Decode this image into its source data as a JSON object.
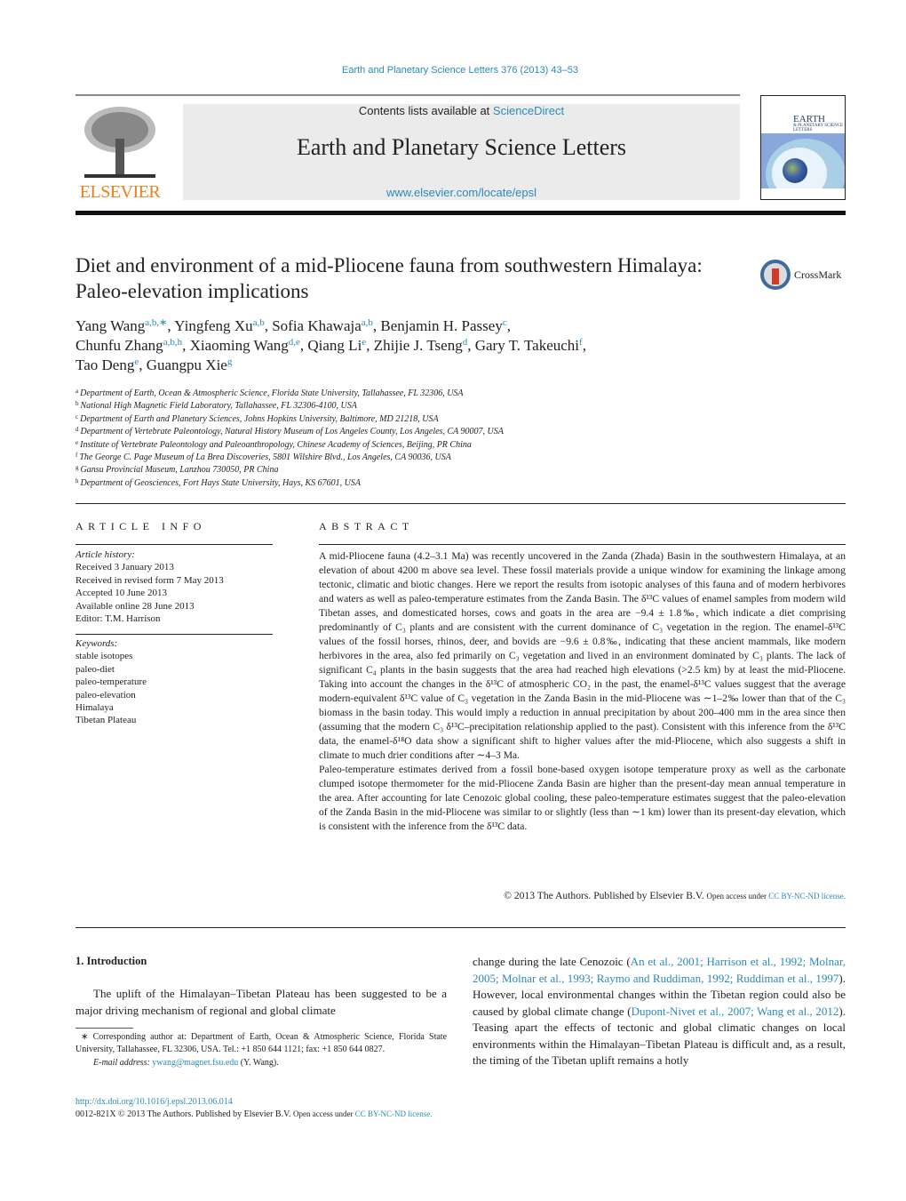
{
  "header": {
    "journal_ref": "Earth and Planetary Science Letters 376 (2013) 43–53",
    "contents_prefix": "Contents lists available at ",
    "contents_link": "ScienceDirect",
    "journal_title": "Earth and Planetary Science Letters",
    "journal_url": "www.elsevier.com/locate/epsl",
    "publisher_logo": "ELSEVIER",
    "cover_title": "EARTH",
    "cover_subtitle": "& PLANETARY SCIENCE LETTERS"
  },
  "crossmark": {
    "label": "CrossMark"
  },
  "article": {
    "title": "Diet and environment of a mid-Pliocene fauna from southwestern Himalaya: Paleo-elevation implications",
    "authors": [
      {
        "name": "Yang Wang",
        "sup": "a,b,∗",
        "sep": ", "
      },
      {
        "name": "Yingfeng Xu",
        "sup": "a,b",
        "sep": ", "
      },
      {
        "name": "Sofia Khawaja",
        "sup": "a,b",
        "sep": ", "
      },
      {
        "name": "Benjamin H. Passey",
        "sup": "c",
        "sep": ","
      },
      {
        "name": "Chunfu Zhang",
        "sup": "a,b,h",
        "sep": ", "
      },
      {
        "name": "Xiaoming Wang",
        "sup": "d,e",
        "sep": ", "
      },
      {
        "name": "Qiang Li",
        "sup": "e",
        "sep": ", "
      },
      {
        "name": "Zhijie J. Tseng",
        "sup": "d",
        "sep": ", "
      },
      {
        "name": "Gary T. Takeuchi",
        "sup": "f",
        "sep": ","
      },
      {
        "name": "Tao Deng",
        "sup": "e",
        "sep": ", "
      },
      {
        "name": "Guangpu Xie",
        "sup": "g",
        "sep": ""
      }
    ],
    "affiliations": [
      {
        "key": "a",
        "text": "Department of Earth, Ocean & Atmospheric Science, Florida State University, Tallahassee, FL 32306, USA"
      },
      {
        "key": "b",
        "text": "National High Magnetic Field Laboratory, Tallahassee, FL 32306-4100, USA"
      },
      {
        "key": "c",
        "text": "Department of Earth and Planetary Sciences, Johns Hopkins University, Baltimore, MD 21218, USA"
      },
      {
        "key": "d",
        "text": "Department of Vertebrate Paleontology, Natural History Museum of Los Angeles County, Los Angeles, CA 90007, USA"
      },
      {
        "key": "e",
        "text": "Institute of Vertebrate Paleontology and Paleoanthropology, Chinese Academy of Sciences, Beijing, PR China"
      },
      {
        "key": "f",
        "text": "The George C. Page Museum of La Brea Discoveries, 5801 Wilshire Blvd., Los Angeles, CA 90036, USA"
      },
      {
        "key": "g",
        "text": "Gansu Provincial Museum, Lanzhou 730050, PR China"
      },
      {
        "key": "h",
        "text": "Department of Geosciences, Fort Hays State University, Hays, KS 67601, USA"
      }
    ]
  },
  "article_info": {
    "heading": "ARTICLE INFO",
    "history_label": "Article history:",
    "history": [
      "Received 3 January 2013",
      "Received in revised form 7 May 2013",
      "Accepted 10 June 2013",
      "Available online 28 June 2013",
      "Editor: T.M. Harrison"
    ],
    "keywords_label": "Keywords:",
    "keywords": [
      "stable isotopes",
      "paleo-diet",
      "paleo-temperature",
      "paleo-elevation",
      "Himalaya",
      "Tibetan Plateau"
    ]
  },
  "abstract": {
    "heading": "ABSTRACT",
    "paragraphs": [
      "A mid-Pliocene fauna (4.2–3.1 Ma) was recently uncovered in the Zanda (Zhada) Basin in the southwestern Himalaya, at an elevation of about 4200 m above sea level. These fossil materials provide a unique window for examining the linkage among tectonic, climatic and biotic changes. Here we report the results from isotopic analyses of this fauna and of modern herbivores and waters as well as paleo-temperature estimates from the Zanda Basin. The δ¹³C values of enamel samples from modern wild Tibetan asses, and domesticated horses, cows and goats in the area are −9.4 ± 1.8‰, which indicate a diet comprising predominantly of C₃ plants and are consistent with the current dominance of C₃ vegetation in the region. The enamel-δ¹³C values of the fossil horses, rhinos, deer, and bovids are −9.6 ± 0.8‰, indicating that these ancient mammals, like modern herbivores in the area, also fed primarily on C₃ vegetation and lived in an environment dominated by C₃ plants. The lack of significant C₄ plants in the basin suggests that the area had reached high elevations (>2.5 km) by at least the mid-Pliocene. Taking into account the changes in the δ¹³C of atmospheric CO₂ in the past, the enamel-δ¹³C values suggest that the average modern-equivalent δ¹³C value of C₃ vegetation in the Zanda Basin in the mid-Pliocene was ∼1–2‰ lower than that of the C₃ biomass in the basin today. This would imply a reduction in annual precipitation by about 200–400 mm in the area since then (assuming that the modern C₃ δ¹³C–precipitation relationship applied to the past). Consistent with this inference from the δ¹³C data, the enamel-δ¹⁸O data show a significant shift to higher values after the mid-Pliocene, which also suggests a shift in climate to much drier conditions after ∼4–3 Ma.",
      "Paleo-temperature estimates derived from a fossil bone-based oxygen isotope temperature proxy as well as the carbonate clumped isotope thermometer for the mid-Pliocene Zanda Basin are higher than the present-day mean annual temperature in the area. After accounting for late Cenozoic global cooling, these paleo-temperature estimates suggest that the paleo-elevation of the Zanda Basin in the mid-Pliocene was similar to or slightly (less than ∼1 km) lower than its present-day elevation, which is consistent with the inference from the δ¹³C data."
    ],
    "copyright": "© 2013 The Authors. Published by Elsevier B.V.",
    "open_access": "Open access under ",
    "license_link": "CC BY-NC-ND license."
  },
  "introduction": {
    "heading": "1. Introduction",
    "left_text": "The uplift of the Himalayan–Tibetan Plateau has been suggested to be a major driving mechanism of regional and global climate",
    "right_parts": [
      {
        "text": "change during the late Cenozoic (",
        "link": false
      },
      {
        "text": "An et al., 2001; Harrison et al., 1992; Molnar, 2005; Molnar et al., 1993; Raymo and Ruddiman, 1992; Ruddiman et al., 1997",
        "link": true
      },
      {
        "text": "). However, local environmental changes within the Tibetan region could also be caused by global climate change (",
        "link": false
      },
      {
        "text": "Dupont-Nivet et al., 2007; Wang et al., 2012",
        "link": true
      },
      {
        "text": "). Teasing apart the effects of tectonic and global climatic changes on local environments within the Himalayan–Tibetan Plateau is difficult and, as a result, the timing of the Tibetan uplift remains a hotly",
        "link": false
      }
    ]
  },
  "footnote": {
    "marker": "∗",
    "text": "Corresponding author at: Department of Earth, Ocean & Atmospheric Science, Florida State University, Tallahassee, FL 32306, USA. Tel.: +1 850 644 1121; fax: +1 850 644 0827.",
    "email_label": "E-mail address:",
    "email": "ywang@magnet.fsu.edu",
    "email_suffix": " (Y. Wang)."
  },
  "footer": {
    "doi": "http://dx.doi.org/10.1016/j.epsl.2013.06.014",
    "copyright": "0012-821X © 2013 The Authors. Published by Elsevier B.V.",
    "open_access": "Open access under ",
    "license_link": "CC BY-NC-ND license."
  },
  "colors": {
    "link": "#2a8ab8",
    "elsevier_orange": "#f07d1a",
    "banner_bg": "#ebebeb"
  }
}
